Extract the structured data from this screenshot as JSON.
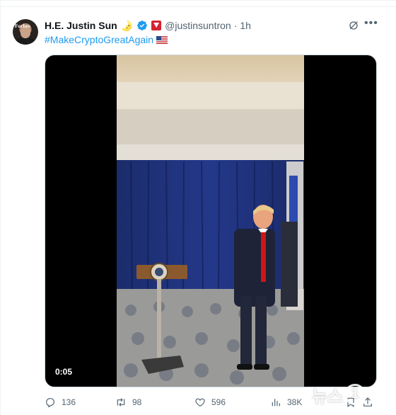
{
  "tweet": {
    "author_name": "H.E. Justin Sun",
    "name_emoji": "🌛",
    "handle": "@justinsuntron",
    "separator": "·",
    "time": "1h",
    "text": "#MakeCryptoGreatAgain",
    "flag": "🇺🇸",
    "avatar_text": "Forbes",
    "video_duration": "0:05"
  },
  "actions": {
    "replies": "136",
    "reposts": "98",
    "likes": "596",
    "views": "38K"
  },
  "icons": {
    "reply": "reply-icon",
    "repost": "repost-icon",
    "like": "heart-icon",
    "views": "views-chart-icon",
    "bookmark": "bookmark-icon",
    "share": "share-icon",
    "grok": "grok-icon",
    "more": "more-icon"
  },
  "colors": {
    "hashtag": "#1d9bf0",
    "verified": "#1d9bf0",
    "secondary_text": "#536471"
  },
  "watermark": {
    "text": "뉴스",
    "circle": "1"
  }
}
